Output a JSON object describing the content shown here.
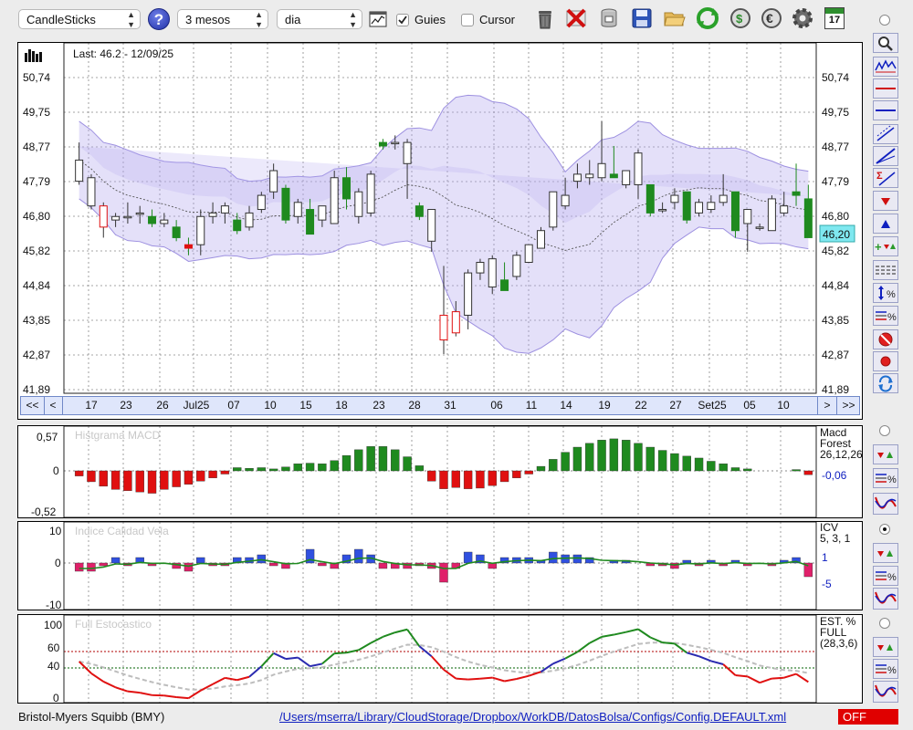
{
  "toolbar": {
    "chart_type": "CandleSticks",
    "period": "3 mesos",
    "interval": "dia",
    "guides_label": "Guies",
    "guides_checked": true,
    "cursor_label": "Cursor",
    "cursor_checked": false,
    "help_icon": "help-icon",
    "calendar_day": "17"
  },
  "price_chart": {
    "last_label": "Last: 46.2 - 12/09/25",
    "y_ticks": [
      "50,74",
      "49,75",
      "48,77",
      "47,79",
      "46,80",
      "45,82",
      "44,84",
      "43,85",
      "42,87",
      "41,89"
    ],
    "current_price": "46,20",
    "x_labels": [
      "17",
      "23",
      "26",
      "Jul25",
      "07",
      "10",
      "15",
      "18",
      "23",
      "28",
      "31",
      "06",
      "11",
      "14",
      "19",
      "22",
      "27",
      "Set25",
      "05",
      "10"
    ],
    "nav_first": "<<",
    "nav_prev": "<",
    "nav_next": ">",
    "nav_last": ">>"
  },
  "macd": {
    "title": "Histgrama MACD",
    "y_ticks": [
      "0,57",
      "0",
      "-0,52"
    ],
    "label_lines": [
      "Macd",
      "Forest",
      "26,12,26"
    ],
    "value": "-0,06"
  },
  "icv": {
    "title": "Indice Calidad Vela",
    "y_ticks": [
      "10",
      "0",
      "-10"
    ],
    "label_lines": [
      "ICV",
      "5, 3, 1"
    ],
    "value_pos": "1",
    "value_neg": "-5"
  },
  "stochastic": {
    "title": "Full Estocastico",
    "y_ticks": [
      "100",
      "60",
      "40",
      "0"
    ],
    "label_lines": [
      "EST. %",
      "FULL",
      "(28,3,6)"
    ]
  },
  "status": {
    "symbol": "Bristol-Myers Squibb (BMY)",
    "config_path": "/Users/mserra/Library/CloudStorage/Dropbox/WorkDB/DatosBolsa/Configs/Config.DEFAULT.xml",
    "state": "OFF"
  },
  "colors": {
    "bull": "#1f8a1f",
    "bear": "#e01010",
    "band_fill": "#b3a6ee",
    "accent_blue": "#1020c0",
    "status_off": "#e00000"
  },
  "chart_data": [
    {
      "type": "candlestick",
      "title": "Last: 46.2 - 12/09/25",
      "ylim": [
        41.89,
        51.2
      ],
      "candles": [
        {
          "o": 47.8,
          "h": 48.9,
          "l": 47.7,
          "c": 48.4
        },
        {
          "o": 47.1,
          "h": 48.0,
          "l": 47.0,
          "c": 47.9
        },
        {
          "o": 46.5,
          "h": 47.2,
          "l": 46.2,
          "c": 47.1
        },
        {
          "o": 46.7,
          "h": 46.9,
          "l": 46.5,
          "c": 46.8
        },
        {
          "o": 46.8,
          "h": 47.2,
          "l": 46.6,
          "c": 46.8
        },
        {
          "o": 46.9,
          "h": 47.1,
          "l": 46.6,
          "c": 46.9
        },
        {
          "o": 46.8,
          "h": 47.0,
          "l": 46.5,
          "c": 46.6
        },
        {
          "o": 46.6,
          "h": 46.9,
          "l": 46.5,
          "c": 46.7
        },
        {
          "o": 46.5,
          "h": 46.7,
          "l": 46.1,
          "c": 46.2
        },
        {
          "o": 46.0,
          "h": 46.2,
          "l": 45.7,
          "c": 45.9
        },
        {
          "o": 46.0,
          "h": 47.0,
          "l": 45.7,
          "c": 46.8
        },
        {
          "o": 46.8,
          "h": 47.2,
          "l": 46.6,
          "c": 46.9
        },
        {
          "o": 46.9,
          "h": 47.2,
          "l": 46.6,
          "c": 47.1
        },
        {
          "o": 46.7,
          "h": 46.9,
          "l": 46.3,
          "c": 46.4
        },
        {
          "o": 46.5,
          "h": 47.1,
          "l": 46.4,
          "c": 46.9
        },
        {
          "o": 47.0,
          "h": 47.5,
          "l": 46.9,
          "c": 47.4
        },
        {
          "o": 47.5,
          "h": 48.3,
          "l": 47.3,
          "c": 48.1
        },
        {
          "o": 47.6,
          "h": 47.7,
          "l": 46.6,
          "c": 46.7
        },
        {
          "o": 46.8,
          "h": 47.3,
          "l": 46.6,
          "c": 47.2
        },
        {
          "o": 47.0,
          "h": 47.3,
          "l": 46.3,
          "c": 46.3
        },
        {
          "o": 46.7,
          "h": 47.1,
          "l": 46.5,
          "c": 47.1
        },
        {
          "o": 46.6,
          "h": 48.1,
          "l": 46.6,
          "c": 47.9
        },
        {
          "o": 47.9,
          "h": 48.2,
          "l": 47.0,
          "c": 47.3
        },
        {
          "o": 46.8,
          "h": 47.6,
          "l": 46.6,
          "c": 47.5
        },
        {
          "o": 46.9,
          "h": 48.1,
          "l": 46.8,
          "c": 48.0
        },
        {
          "o": 48.9,
          "h": 49.0,
          "l": 48.7,
          "c": 48.8
        },
        {
          "o": 48.9,
          "h": 49.1,
          "l": 48.7,
          "c": 48.9
        },
        {
          "o": 48.3,
          "h": 49.0,
          "l": 47.3,
          "c": 48.9
        },
        {
          "o": 47.1,
          "h": 47.2,
          "l": 46.7,
          "c": 46.8
        },
        {
          "o": 46.1,
          "h": 47.0,
          "l": 45.8,
          "c": 47.0
        },
        {
          "o": 43.3,
          "h": 45.4,
          "l": 42.9,
          "c": 44.0
        },
        {
          "o": 43.5,
          "h": 44.4,
          "l": 43.4,
          "c": 44.1
        },
        {
          "o": 44.0,
          "h": 45.3,
          "l": 43.6,
          "c": 45.2
        },
        {
          "o": 45.2,
          "h": 45.6,
          "l": 45.0,
          "c": 45.5
        },
        {
          "o": 44.8,
          "h": 45.7,
          "l": 44.6,
          "c": 45.6
        },
        {
          "o": 45.0,
          "h": 45.5,
          "l": 44.7,
          "c": 44.7
        },
        {
          "o": 45.1,
          "h": 45.8,
          "l": 45.0,
          "c": 45.7
        },
        {
          "o": 45.5,
          "h": 46.0,
          "l": 45.5,
          "c": 46.0
        },
        {
          "o": 45.9,
          "h": 46.5,
          "l": 45.9,
          "c": 46.4
        },
        {
          "o": 46.5,
          "h": 47.5,
          "l": 46.4,
          "c": 47.5
        },
        {
          "o": 47.1,
          "h": 47.9,
          "l": 47.0,
          "c": 47.4
        },
        {
          "o": 47.8,
          "h": 48.3,
          "l": 47.6,
          "c": 48.0
        },
        {
          "o": 47.9,
          "h": 48.4,
          "l": 47.7,
          "c": 48.0
        },
        {
          "o": 47.9,
          "h": 49.5,
          "l": 47.8,
          "c": 48.3
        },
        {
          "o": 48.0,
          "h": 48.8,
          "l": 47.9,
          "c": 47.9
        },
        {
          "o": 47.7,
          "h": 48.1,
          "l": 47.6,
          "c": 48.1
        },
        {
          "o": 47.7,
          "h": 48.7,
          "l": 47.3,
          "c": 48.6
        },
        {
          "o": 47.7,
          "h": 47.7,
          "l": 46.8,
          "c": 46.9
        },
        {
          "o": 47.0,
          "h": 47.2,
          "l": 46.9,
          "c": 47.0
        },
        {
          "o": 47.2,
          "h": 47.6,
          "l": 47.0,
          "c": 47.4
        },
        {
          "o": 47.5,
          "h": 47.5,
          "l": 46.6,
          "c": 46.7
        },
        {
          "o": 46.9,
          "h": 47.3,
          "l": 46.8,
          "c": 47.2
        },
        {
          "o": 47.0,
          "h": 47.4,
          "l": 46.9,
          "c": 47.2
        },
        {
          "o": 47.2,
          "h": 48.0,
          "l": 47.1,
          "c": 47.4
        },
        {
          "o": 47.5,
          "h": 47.5,
          "l": 46.2,
          "c": 46.4
        },
        {
          "o": 46.6,
          "h": 47.0,
          "l": 45.8,
          "c": 47.0
        },
        {
          "o": 46.5,
          "h": 46.6,
          "l": 46.4,
          "c": 46.5
        },
        {
          "o": 46.4,
          "h": 47.4,
          "l": 46.4,
          "c": 47.3
        },
        {
          "o": 46.9,
          "h": 47.5,
          "l": 46.8,
          "c": 47.1
        },
        {
          "o": 47.5,
          "h": 48.3,
          "l": 47.1,
          "c": 47.4
        },
        {
          "o": 47.3,
          "h": 47.7,
          "l": 46.2,
          "c": 46.2
        }
      ]
    },
    {
      "type": "bar",
      "title": "Histgrama MACD",
      "ylim": [
        -0.52,
        0.57
      ],
      "values": [
        -0.08,
        -0.17,
        -0.24,
        -0.29,
        -0.31,
        -0.33,
        -0.35,
        -0.29,
        -0.25,
        -0.21,
        -0.16,
        -0.11,
        -0.05,
        0.05,
        0.04,
        0.05,
        0.03,
        0.06,
        0.11,
        0.12,
        0.11,
        0.16,
        0.24,
        0.33,
        0.38,
        0.38,
        0.33,
        0.22,
        0.08,
        -0.16,
        -0.28,
        -0.26,
        -0.28,
        -0.27,
        -0.23,
        -0.17,
        -0.11,
        -0.05,
        0.07,
        0.18,
        0.29,
        0.37,
        0.43,
        0.48,
        0.5,
        0.48,
        0.43,
        0.37,
        0.32,
        0.27,
        0.23,
        0.2,
        0.15,
        0.11,
        0.05,
        0.03,
        0,
        0,
        0,
        0.02,
        -0.06
      ]
    },
    {
      "type": "bar",
      "title": "Indice Calidad Vela",
      "ylim": [
        -10,
        10
      ],
      "values": [
        -3,
        -3,
        -1,
        2,
        -1,
        2,
        -1,
        0,
        -2,
        -3,
        2,
        -1,
        -1,
        2,
        2,
        3,
        -1,
        -2,
        0,
        5,
        -1,
        -2,
        3,
        5,
        3,
        -2,
        -2,
        -2,
        -1,
        -2,
        -7,
        -2,
        4,
        3,
        -2,
        2,
        2,
        2,
        1,
        4,
        3,
        3,
        2,
        0,
        1,
        1,
        0,
        -1,
        -1,
        -2,
        1,
        -1,
        1,
        -1,
        1,
        -1,
        0,
        -1,
        1,
        2,
        -5
      ]
    },
    {
      "type": "line",
      "title": "Full Estocastico",
      "ylim": [
        0,
        100
      ]
    }
  ]
}
